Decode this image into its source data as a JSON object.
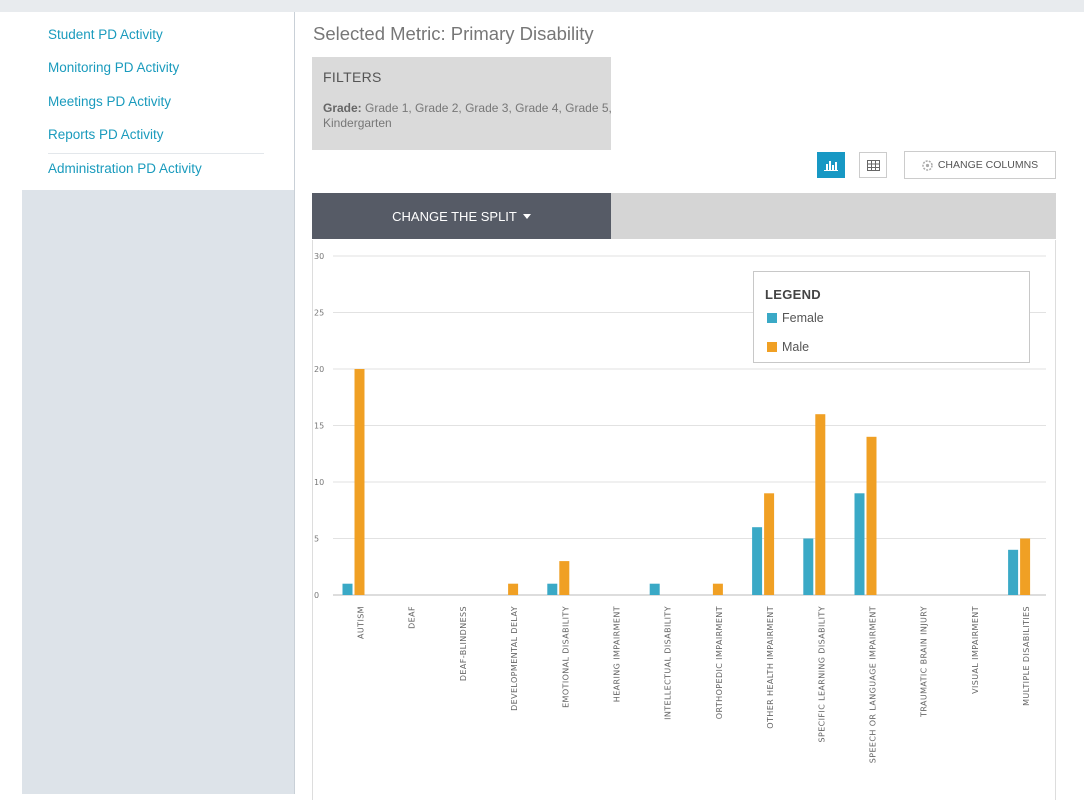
{
  "sidebar": {
    "items": [
      {
        "label": "Student PD Activity"
      },
      {
        "label": "Monitoring PD Activity"
      },
      {
        "label": "Meetings PD Activity"
      },
      {
        "label": "Reports PD Activity"
      },
      {
        "label": "Administration PD Activity"
      }
    ]
  },
  "main": {
    "title": "Selected Metric: Primary Disability",
    "filters": {
      "heading": "FILTERS",
      "grade_label": "Grade:",
      "grade_value": "Grade 1, Grade 2, Grade 3, Grade 4, Grade 5, Kindergarten"
    },
    "toolbar": {
      "chart_view_icon": "bar-chart-icon",
      "table_view_icon": "table-grid-icon",
      "change_columns_label": "CHANGE COLUMNS",
      "change_columns_icon": "gear-icon"
    },
    "split": {
      "label": "CHANGE THE SPLIT"
    },
    "legend": {
      "title": "LEGEND"
    }
  },
  "colors": {
    "accent": "#1798c4",
    "female": "#3aa9c6",
    "male": "#f0a024",
    "split_button": "#565b66"
  },
  "chart_data": {
    "type": "bar",
    "categories": [
      "AUTISM",
      "DEAF",
      "DEAF-BLINDNESS",
      "DEVELOPMENTAL DELAY",
      "EMOTIONAL DISABILITY",
      "HEARING IMPAIRMENT",
      "INTELLECTUAL DISABILITY",
      "ORTHOPEDIC IMPAIRMENT",
      "OTHER HEALTH IMPAIRMENT",
      "SPECIFIC LEARNING DISABILITY",
      "SPEECH OR LANGUAGE IMPAIRMENT",
      "TRAUMATIC BRAIN INJURY",
      "VISUAL IMPAIRMENT",
      "MULTIPLE DISABILITIES"
    ],
    "series": [
      {
        "name": "Female",
        "color": "#3aa9c6",
        "values": [
          1,
          0,
          0,
          0,
          1,
          0,
          1,
          0,
          6,
          5,
          9,
          0,
          0,
          4
        ]
      },
      {
        "name": "Male",
        "color": "#f0a024",
        "values": [
          20,
          0,
          0,
          1,
          3,
          0,
          0,
          1,
          9,
          16,
          14,
          0,
          0,
          5
        ]
      }
    ],
    "ylim": [
      0,
      30
    ],
    "yticks": [
      0,
      5,
      10,
      15,
      20,
      25,
      30
    ],
    "grid": true,
    "legend_position": "top-right"
  }
}
